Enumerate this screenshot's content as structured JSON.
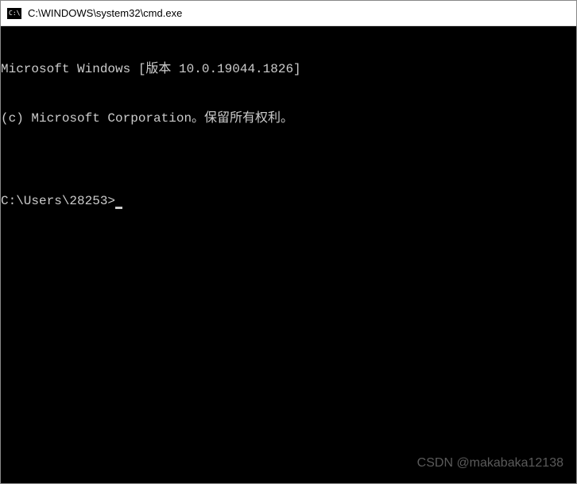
{
  "titlebar": {
    "icon_label": "C:\\",
    "title": "C:\\WINDOWS\\system32\\cmd.exe"
  },
  "terminal": {
    "line1": "Microsoft Windows [版本 10.0.19044.1826]",
    "line2": "(c) Microsoft Corporation。保留所有权利。",
    "blank": "",
    "prompt": "C:\\Users\\28253>"
  },
  "watermark": "CSDN @makabaka12138"
}
